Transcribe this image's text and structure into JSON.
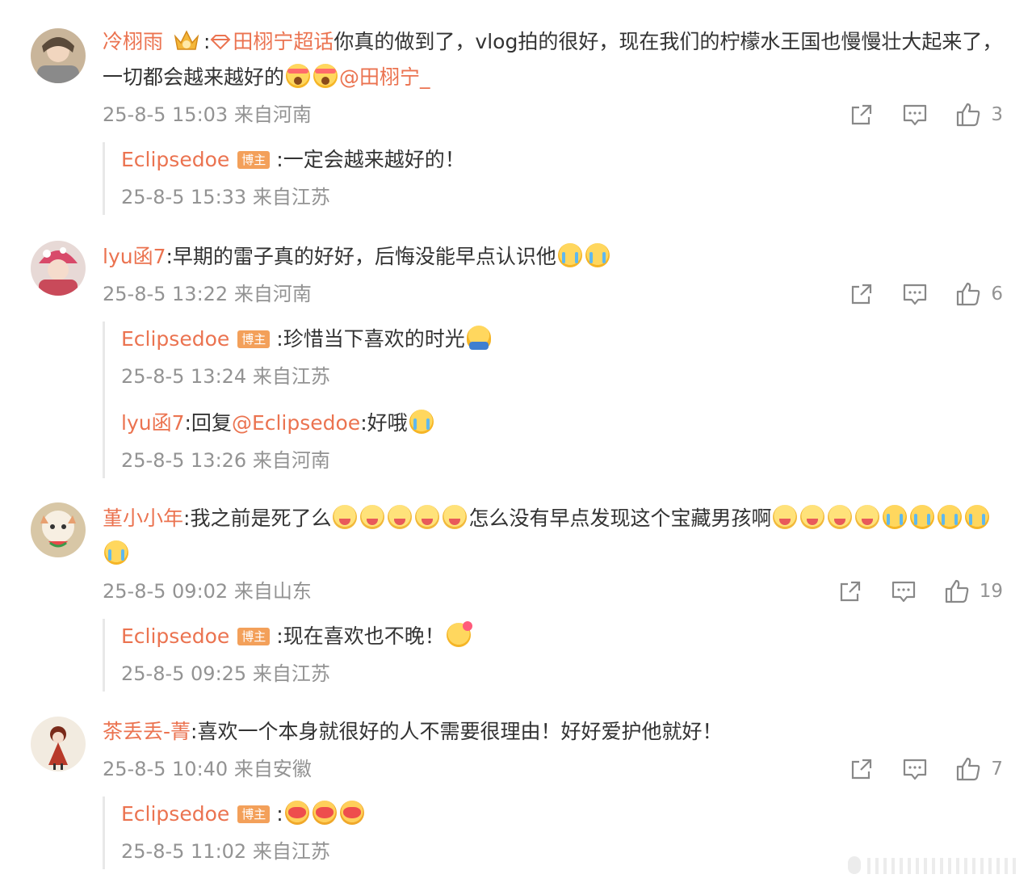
{
  "comments": [
    {
      "user": "冷栩雨",
      "supertopic": "田栩宁超话",
      "text1": "你真的做到了，vlog拍的很好，现在我们的柠檬水王国也慢慢壮大起来了，一切都会越来越好的",
      "mention": "@田栩宁_",
      "time": "25-8-5 15:03 来自河南",
      "likes": "3",
      "replies": [
        {
          "user": "Eclipsedoe",
          "badge": "博主",
          "text": ":一定会越来越好的！",
          "time": "25-8-5 15:33 来自江苏"
        }
      ]
    },
    {
      "user": "lyu函7",
      "text1": ":早期的雷子真的好好，后悔没能早点认识他",
      "time": "25-8-5 13:22 来自河南",
      "likes": "6",
      "replies": [
        {
          "user": "Eclipsedoe",
          "badge": "博主",
          "text": ":珍惜当下喜欢的时光",
          "time": "25-8-5 13:24 来自江苏"
        },
        {
          "user": "lyu函7",
          "prefix": ":回复",
          "mention": "@Eclipsedoe",
          "text": ":好哦",
          "time": "25-8-5 13:26 来自河南"
        }
      ]
    },
    {
      "user": "堇小小年",
      "text1": ":我之前是死了么",
      "text2": "怎么没有早点发现这个宝藏男孩啊",
      "time": "25-8-5 09:02 来自山东",
      "likes": "19",
      "replies": [
        {
          "user": "Eclipsedoe",
          "badge": "博主",
          "text": ":现在喜欢也不晚！",
          "time": "25-8-5 09:25 来自江苏"
        }
      ]
    },
    {
      "user": "茶丢丢-菁",
      "text1": ":喜欢一个本身就很好的人不需要很理由！好好爱护他就好！",
      "time": "25-8-5 10:40 来自安徽",
      "likes": "7",
      "replies": [
        {
          "user": "Eclipsedoe",
          "badge": "博主",
          "text": ":",
          "time": "25-8-5 11:02 来自江苏"
        }
      ]
    }
  ],
  "icons": {
    "share": "share-icon",
    "comment": "comment-icon",
    "like": "thumbs-up-icon"
  },
  "colors": {
    "username": "#eb7350",
    "meta": "#939393",
    "badge": "#f3a05a"
  }
}
